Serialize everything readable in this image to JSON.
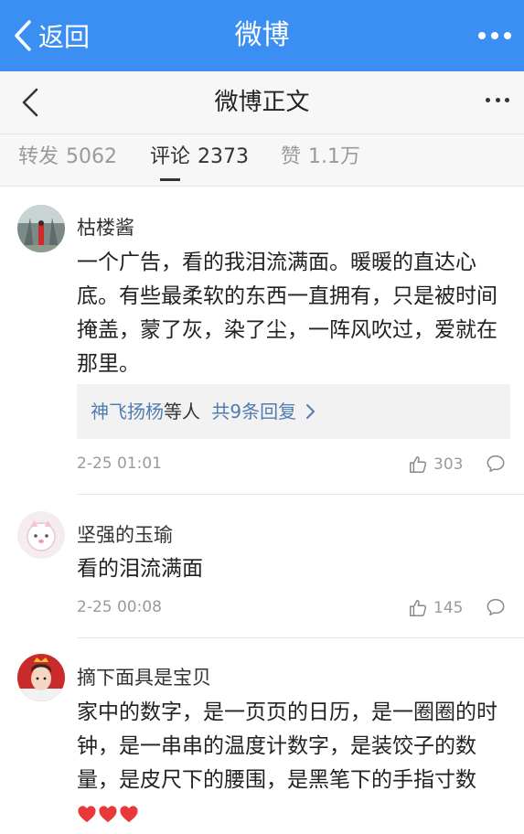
{
  "top_bar": {
    "back_label": "返回",
    "title": "微博"
  },
  "nav_bar": {
    "title": "微博正文"
  },
  "tabs": [
    {
      "label": "转发",
      "count": "5062"
    },
    {
      "label": "评论",
      "count": "2373"
    },
    {
      "label": "赞",
      "count": "1.1万"
    }
  ],
  "comments": [
    {
      "username": "枯楼酱",
      "text": "一个广告，看的我泪流满面。暖暖的直达心底。有些最柔软的东西一直拥有，只是被时间掩盖，蒙了灰，染了尘，一阵风吹过，爱就在那里。",
      "replies": {
        "names": "神飞扬杨",
        "mid": "等人",
        "total": "共9条回复"
      },
      "time": "2-25 01:01",
      "likes": "303"
    },
    {
      "username": "坚强的玉瑜",
      "text": "看的泪流满面",
      "time": "2-25 00:08",
      "likes": "145"
    },
    {
      "username": "摘下面具是宝贝",
      "text": "家中的数字，是一页页的日历，是一圈圈的时钟，是一串串的温度计数字，是装饺子的数量，是皮尺下的腰围，是黑笔下的手指寸数"
    }
  ],
  "colors": {
    "top_bar": "#3b8ff3",
    "link_blue": "#507daf",
    "heart_red": "#e8383a"
  },
  "icons": [
    "chevron-left-icon",
    "more-icon",
    "thumb-up-icon",
    "comment-bubble-icon",
    "heart-icon",
    "chevron-right-icon"
  ]
}
